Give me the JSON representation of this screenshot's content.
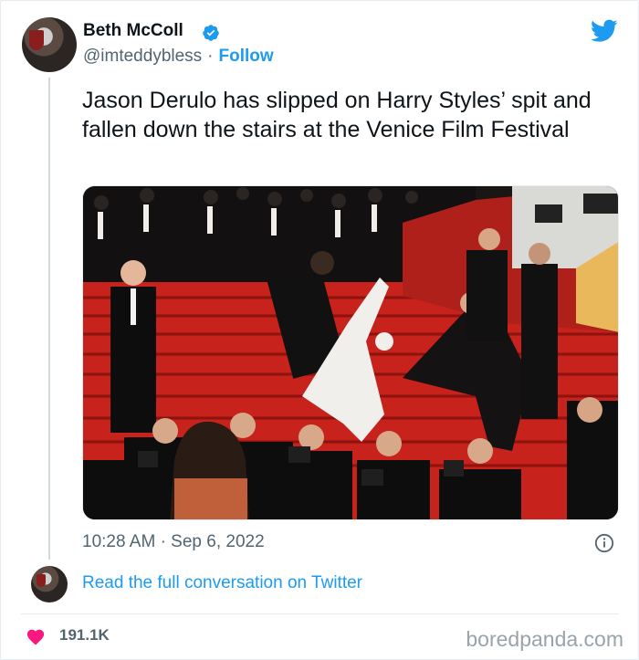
{
  "author": {
    "name": "Beth McColl",
    "handle": "@imteddybless",
    "separator": "·",
    "follow_label": "Follow",
    "verified": true
  },
  "tweet": {
    "text": "Jason Derulo has slipped on Harry Styles’ spit and fallen down the stairs at the Venice Film Festival",
    "photo_icon": "red-carpet-photo",
    "time": "10:28 AM",
    "date_separator": "·",
    "date": "Sep 6, 2022"
  },
  "conversation": {
    "link_label": "Read the full conversation on Twitter"
  },
  "footer": {
    "likes": "191.1K",
    "watermark": "boredpanda.com"
  },
  "colors": {
    "accent": "#1d9bf0",
    "heart": "#f91880",
    "muted": "#536471",
    "text": "#0f1419"
  }
}
